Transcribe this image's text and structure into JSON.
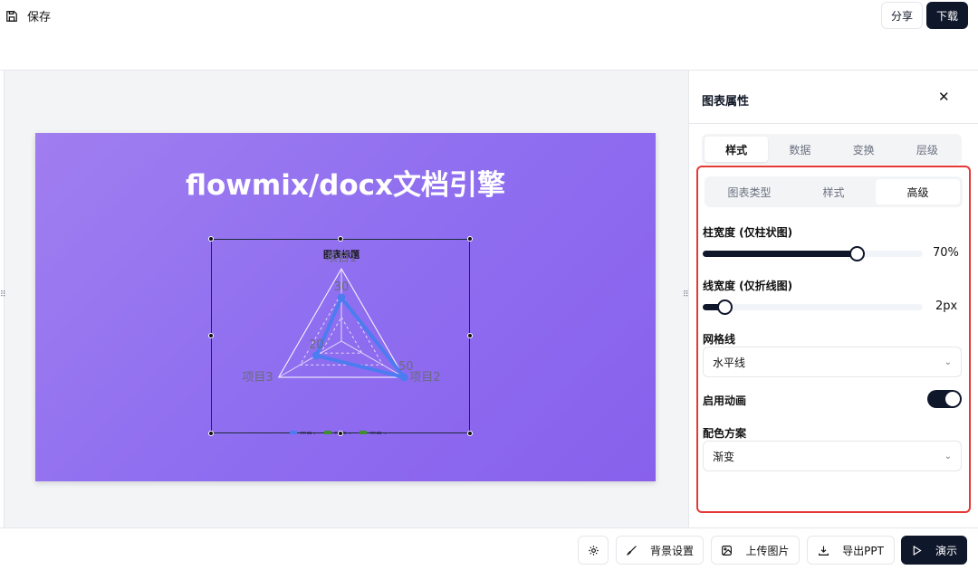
{
  "toolbar": {
    "save_label": "保存",
    "share_label": "分享",
    "download_label": "下载"
  },
  "slide": {
    "title": "flowmix/docx文档引擎"
  },
  "chart_data": {
    "type": "radar",
    "title": "图表标题",
    "categories": [
      "项目1",
      "项目2",
      "项目3"
    ],
    "series": [
      {
        "name": "项目1",
        "values": [
          30,
          50,
          20
        ]
      },
      {
        "name": "项目2",
        "values": []
      },
      {
        "name": "项目3",
        "values": []
      }
    ],
    "data_labels": [
      "30",
      "50",
      "20"
    ],
    "legend": [
      "项目1",
      "项目2",
      "项目3"
    ],
    "legend_position": "bottom",
    "range": [
      0,
      50
    ],
    "colors": {
      "series1": "#4c7cf0",
      "series2": "#3f8f2a",
      "series3": "#3f8f2a"
    }
  },
  "panel": {
    "title": "图表属性",
    "tabs": [
      "样式",
      "数据",
      "变换",
      "层级"
    ],
    "active_tab": 0,
    "subtabs": [
      "图表类型",
      "样式",
      "高级"
    ],
    "active_subtab": 2,
    "bar_width": {
      "label": "柱宽度 (仅柱状图)",
      "value": 0.7,
      "display": "70%"
    },
    "line_width": {
      "label": "线宽度 (仅折线图)",
      "value": 0.1,
      "display": "2px"
    },
    "grid": {
      "label": "网格线",
      "selected": "水平线"
    },
    "animation": {
      "label": "启用动画",
      "enabled": true
    },
    "palette": {
      "label": "配色方案",
      "selected": "渐变"
    }
  },
  "bottom": {
    "bg_label": "背景设置",
    "upload_label": "上传图片",
    "export_label": "导出PPT",
    "present_label": "演示"
  },
  "colors": {
    "accent": "#0f172a",
    "highlight": "#e53935",
    "slide_bg": "#9370ee"
  }
}
